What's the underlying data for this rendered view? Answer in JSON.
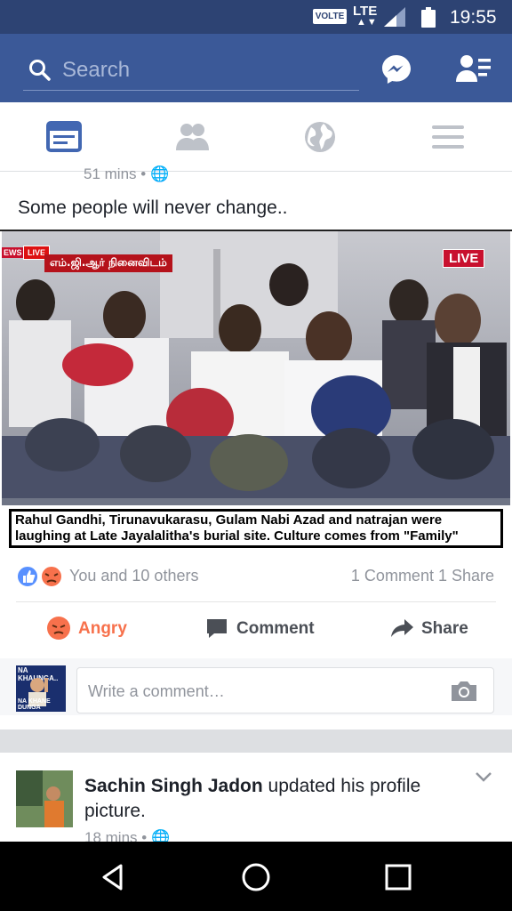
{
  "status_bar": {
    "network_badge": "VOLTE",
    "network_type": "LTE",
    "time": "19:55"
  },
  "header": {
    "search": {
      "placeholder": "Search"
    },
    "icons": [
      "search-icon",
      "messenger-icon",
      "friend-requests-icon"
    ]
  },
  "nav_tabs": [
    "news-feed-icon",
    "friends-icon",
    "notifications-globe-icon",
    "menu-icon"
  ],
  "post1": {
    "meta": "51 mins •",
    "text": "Some people will never change..",
    "image": {
      "channel_badge": "EWS",
      "live_tag_left": "LIVE",
      "banner_text": "எம்.ஜி.ஆர் நினைவிடம்",
      "live_tag_right": "LIVE",
      "caption_line1": "Rahul Gandhi, Tirunavukarasu, Gulam Nabi Azad and natrajan were",
      "caption_line2": "laughing at Late Jayalalitha's burial site. Culture comes from \"Family\""
    },
    "reactions_text": "You and 10 others",
    "counts_text": "1 Comment 1 Share",
    "actions": {
      "angry": "Angry",
      "comment": "Comment",
      "share": "Share"
    },
    "commenter_thumb": {
      "top_text": "NA KHAUNGA..",
      "bottom_text": "NA KHANE DUNGA"
    },
    "comment_placeholder": "Write a comment…"
  },
  "post2": {
    "author": "Sachin Singh Jadon",
    "action_text": " updated his profile picture.",
    "meta": "18 mins •"
  },
  "colors": {
    "fb_blue": "#3b5998",
    "status_bar": "#2d4373",
    "angry_orange": "#f7714c"
  }
}
